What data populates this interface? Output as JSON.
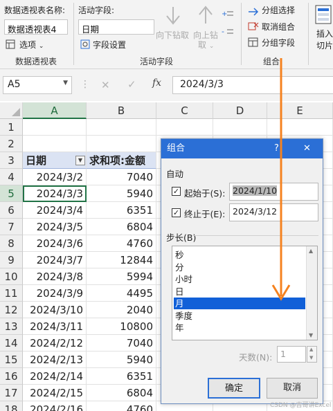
{
  "ribbon": {
    "pivot_name_label": "数据透视表名称:",
    "pivot_name_value": "数据透视表4",
    "options_label": "选项",
    "group_pivot_label": "数据透视表",
    "active_field_label": "活动字段:",
    "active_field_value": "日期",
    "field_settings_label": "字段设置",
    "drill_down_label": "向下钻取",
    "drill_up_label": "向上钻",
    "drill_up_suffix": "取",
    "group_active_field_label": "活动字段",
    "group_selection_label": "分组选择",
    "ungroup_label": "取消组合",
    "group_field_label": "分组字段",
    "group_group_label": "组合",
    "insert_label_1": "插入",
    "insert_label_2": "切片器"
  },
  "formula_bar": {
    "name_box": "A5",
    "formula": "2024/3/3"
  },
  "grid": {
    "columns": [
      "A",
      "B",
      "C",
      "D",
      "E"
    ],
    "rows": [
      {
        "num": "1",
        "a": "",
        "b": ""
      },
      {
        "num": "2",
        "a": "",
        "b": ""
      },
      {
        "num": "3",
        "a": "日期",
        "b": "求和项:金额"
      },
      {
        "num": "4",
        "a": "2024/3/2",
        "b": "7040"
      },
      {
        "num": "5",
        "a": "2024/3/3",
        "b": "5940"
      },
      {
        "num": "6",
        "a": "2024/3/4",
        "b": "6351"
      },
      {
        "num": "7",
        "a": "2024/3/5",
        "b": "6804"
      },
      {
        "num": "8",
        "a": "2024/3/6",
        "b": "4760"
      },
      {
        "num": "9",
        "a": "2024/3/7",
        "b": "12844"
      },
      {
        "num": "10",
        "a": "2024/3/8",
        "b": "5994"
      },
      {
        "num": "11",
        "a": "2024/3/9",
        "b": "4495"
      },
      {
        "num": "12",
        "a": "2024/3/10",
        "b": "2040"
      },
      {
        "num": "13",
        "a": "2024/3/11",
        "b": "10800"
      },
      {
        "num": "14",
        "a": "2024/2/12",
        "b": "7040"
      },
      {
        "num": "15",
        "a": "2024/2/13",
        "b": "5940"
      },
      {
        "num": "16",
        "a": "2024/2/14",
        "b": "6351"
      },
      {
        "num": "17",
        "a": "2024/2/15",
        "b": "6804"
      },
      {
        "num": "18",
        "a": "2024/2/16",
        "b": "4760"
      }
    ]
  },
  "dialog": {
    "title": "组合",
    "help": "?",
    "close": "✕",
    "auto_label": "自动",
    "start_label": "起始于(S):",
    "start_value": "2024/1/10",
    "end_label": "终止于(E):",
    "end_value": "2024/3/12",
    "step_label": "步长(B)",
    "step_items": [
      "秒",
      "分",
      "小时",
      "日",
      "月",
      "季度",
      "年"
    ],
    "step_selected": "月",
    "days_label": "天数(N):",
    "days_value": "1",
    "ok_label": "确定",
    "cancel_label": "取消"
  },
  "watermark": "CSDN @吉哥讲Excel",
  "colors": {
    "accent_green": "#217346",
    "dialog_title_blue": "#2b6fd6",
    "list_selected_blue": "#1160d8",
    "arrow_orange": "#f5821f"
  }
}
